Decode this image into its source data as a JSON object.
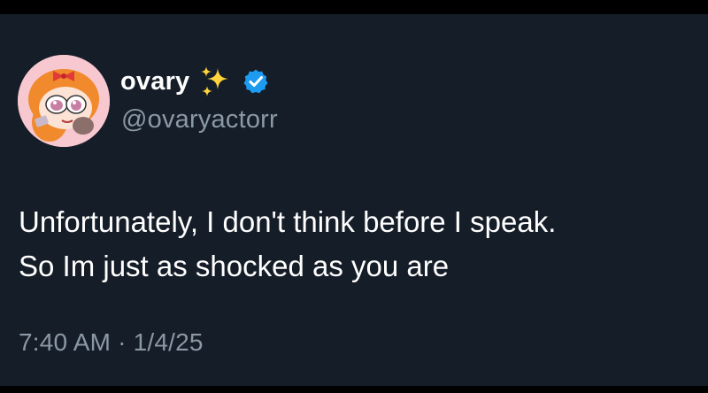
{
  "tweet": {
    "display_name": "ovary",
    "handle": "@ovaryactorr",
    "text_lines": [
      "Unfortunately, I don't think before I speak.",
      "So Im just as shocked as you are"
    ],
    "time": "7:40 AM",
    "separator": "·",
    "date": "1/4/25",
    "icons": {
      "name_emoji": "sparkles-icon",
      "badge": "verified-badge-icon",
      "avatar": "cartoon-girl-avatar"
    }
  },
  "colors": {
    "background": "#151d28",
    "frame": "#000000",
    "primary_text": "#ffffff",
    "secondary_text": "#8b98a5",
    "verified_blue": "#1d9bf0",
    "sparkle_yellow": "#ffd43b",
    "avatar_bg": "#f7c8cf"
  }
}
